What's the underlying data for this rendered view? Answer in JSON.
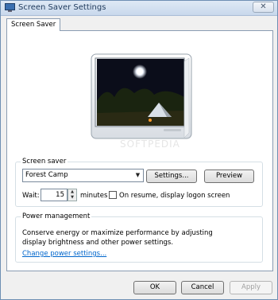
{
  "window": {
    "title": "Screen Saver Settings",
    "close_glyph": "✕"
  },
  "tabs": [
    {
      "label": "Screen Saver"
    }
  ],
  "preview": {
    "icon": "monitor-preview-forest-camp"
  },
  "screen_saver": {
    "group_label": "Screen saver",
    "selected": "Forest Camp",
    "settings_label": "Settings...",
    "preview_label": "Preview",
    "wait_label": "Wait:",
    "wait_value": "15",
    "minutes_label": "minutes",
    "resume_label": "On resume, display logon screen",
    "resume_checked": false
  },
  "power": {
    "group_label": "Power management",
    "description": "Conserve energy or maximize performance by adjusting display brightness and other power settings.",
    "link_label": "Change power settings..."
  },
  "buttons": {
    "ok": "OK",
    "cancel": "Cancel",
    "apply": "Apply"
  },
  "watermark": "SOFTPEDIA"
}
